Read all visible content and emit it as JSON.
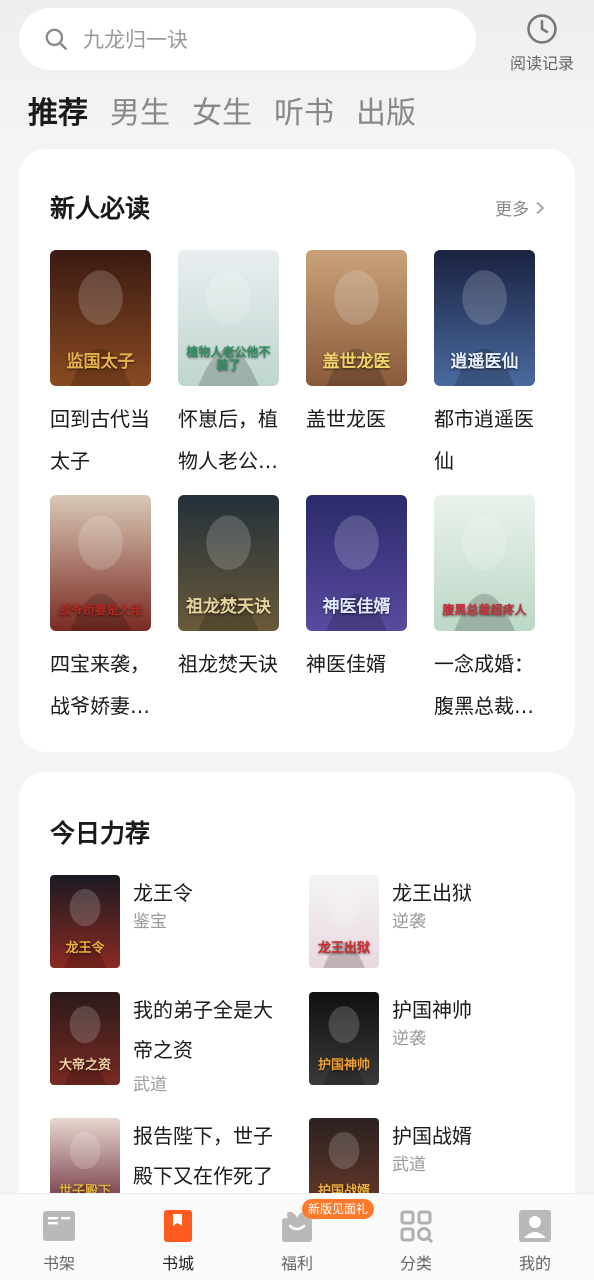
{
  "search": {
    "placeholder": "九龙归一诀"
  },
  "history": {
    "label": "阅读记录"
  },
  "tabs": [
    "推荐",
    "男生",
    "女生",
    "听书",
    "出版"
  ],
  "section1": {
    "title": "新人必读",
    "more": "更多",
    "books": [
      {
        "title": "回到古代当太子",
        "cover_text": "监国太子",
        "cover_colors": [
          "#3a1a12",
          "#8a4a22",
          "#e6b24a"
        ]
      },
      {
        "title": "怀崽后，植物人老公…",
        "cover_text": "植物人老公他不装了",
        "cover_colors": [
          "#e9eef0",
          "#bfd6d0",
          "#2e8f5e"
        ]
      },
      {
        "title": "盖世龙医",
        "cover_text": "盖世龙医",
        "cover_colors": [
          "#c9a27a",
          "#8a5a3a",
          "#f2d46a"
        ]
      },
      {
        "title": "都市逍遥医仙",
        "cover_text": "逍遥医仙",
        "cover_colors": [
          "#1a2240",
          "#4a6aa0",
          "#e8f0ff"
        ]
      },
      {
        "title": "四宝来袭，战爷娇妻…",
        "cover_text": "战爷娇妻是大佬",
        "cover_colors": [
          "#d9c9b6",
          "#7a2a22",
          "#b02a22"
        ]
      },
      {
        "title": "祖龙焚天诀",
        "cover_text": "祖龙焚天诀",
        "cover_colors": [
          "#22303a",
          "#6a5a3a",
          "#e8d6a0"
        ]
      },
      {
        "title": "神医佳婿",
        "cover_text": "神医佳婿",
        "cover_colors": [
          "#2a2a6a",
          "#5a4aa0",
          "#e0e8ff"
        ]
      },
      {
        "title": "一念成婚：腹黑总裁…",
        "cover_text": "腹黑总裁超疼人",
        "cover_colors": [
          "#eaf2ec",
          "#bcd8c6",
          "#c0303a"
        ]
      }
    ]
  },
  "section2": {
    "title": "今日力荐",
    "books": [
      {
        "title_line1": "龙王令",
        "title_line2": "",
        "genre": "鉴宝",
        "cover_text": "龙王令",
        "cover_colors": [
          "#1a1a22",
          "#8a2a22",
          "#e8b23a"
        ]
      },
      {
        "title_line1": "龙王出狱",
        "title_line2": "",
        "genre": "逆袭",
        "cover_text": "龙王出狱",
        "cover_colors": [
          "#f4f4f6",
          "#e8d8e0",
          "#d02a2a"
        ]
      },
      {
        "title_line1": "我的弟子全是大",
        "title_line2": "帝之资",
        "genre": "武道",
        "cover_text": "大帝之资",
        "cover_colors": [
          "#2a1a1a",
          "#7a2a22",
          "#f0d0a0"
        ]
      },
      {
        "title_line1": "护国神帅",
        "title_line2": "",
        "genre": "逆袭",
        "cover_text": "护国神帅",
        "cover_colors": [
          "#101010",
          "#3a3a3a",
          "#f0a030"
        ]
      },
      {
        "title_line1": "报告陛下，世子",
        "title_line2": "殿下又在作死了",
        "genre": "",
        "cover_text": "世子殿下",
        "cover_colors": [
          "#e8d8d0",
          "#6a2a3a",
          "#e0b040"
        ]
      },
      {
        "title_line1": "护国战婿",
        "title_line2": "",
        "genre": "武道",
        "cover_text": "护国战婿",
        "cover_colors": [
          "#2a2020",
          "#6a3a2a",
          "#f0b040"
        ]
      }
    ]
  },
  "nav": {
    "items": [
      {
        "label": "书架",
        "icon": "bookshelf-icon"
      },
      {
        "label": "书城",
        "icon": "bookstore-icon"
      },
      {
        "label": "福利",
        "icon": "gift-icon"
      },
      {
        "label": "分类",
        "icon": "category-icon"
      },
      {
        "label": "我的",
        "icon": "profile-icon"
      }
    ],
    "badge": "新版见面礼",
    "active": "书城"
  },
  "colors": {
    "accent": "#ff5a1f",
    "background": "#f5f5f5",
    "card": "#ffffff"
  }
}
